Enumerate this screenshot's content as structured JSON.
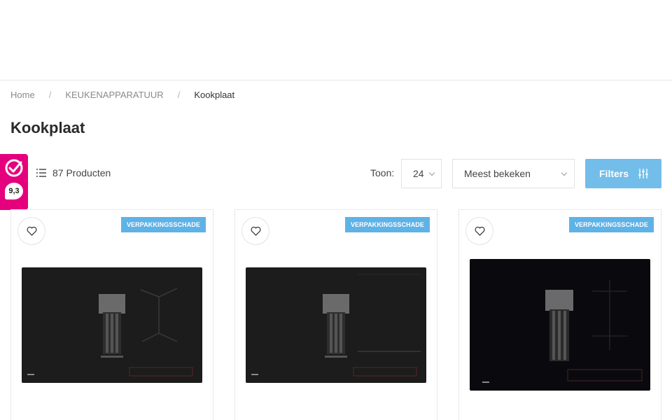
{
  "breadcrumb": {
    "items": [
      "Home",
      "KEUKENAPPARATUUR",
      "Kookplaat"
    ],
    "separator": "/"
  },
  "page_title": "Kookplaat",
  "review_badge": {
    "score": "9,3",
    "color": "#e5007d",
    "icon": "kiyoh-check-icon"
  },
  "toolbar": {
    "product_count": "87 Producten",
    "show_label": "Toon:",
    "per_page_value": "24",
    "sort_value": "Meest bekeken",
    "filters_label": "Filters",
    "filters_color": "#72bdea"
  },
  "products": [
    {
      "tag": "VERPAKKINGSSCHADE",
      "image": "induction-hob-with-downdraft-image"
    },
    {
      "tag": "VERPAKKINGSSCHADE",
      "image": "induction-hob-with-downdraft-image"
    },
    {
      "tag": "VERPAKKINGSSCHADE",
      "image": "induction-hob-with-downdraft-image"
    }
  ],
  "colors": {
    "tag": "#5fb2e6",
    "hob": "#1a1a1a"
  }
}
